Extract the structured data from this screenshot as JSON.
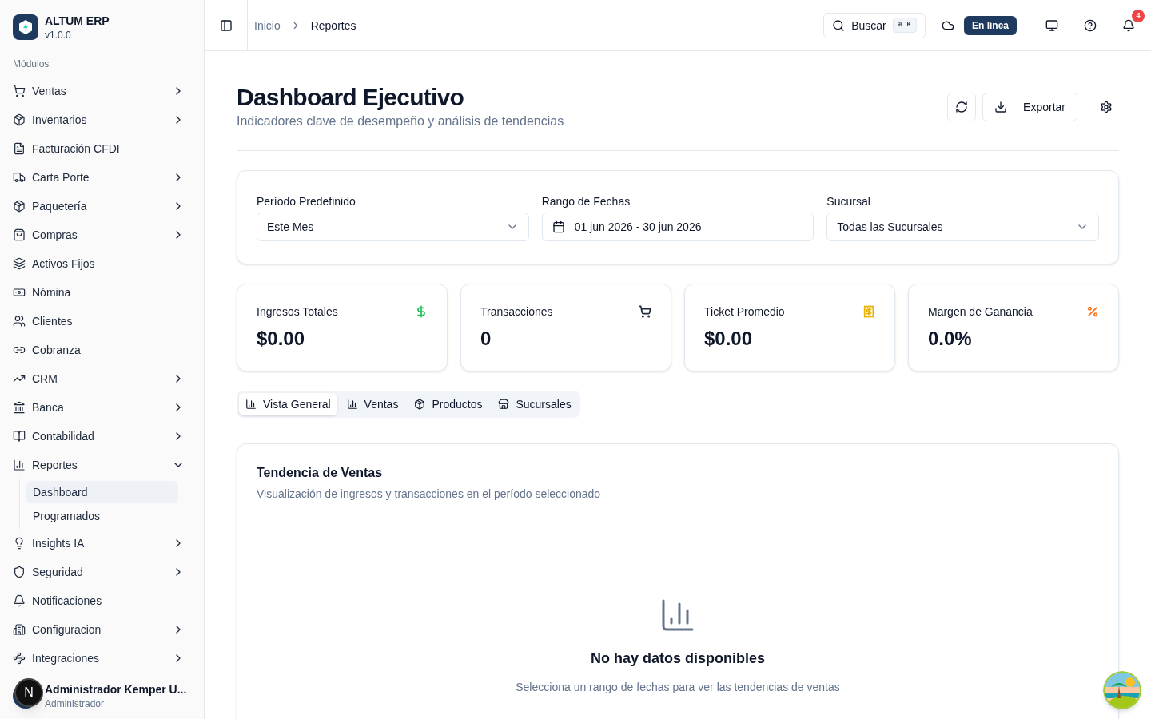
{
  "brand": {
    "name": "ALTUM ERP",
    "version": "v1.0.0"
  },
  "sidebar": {
    "section": "Módulos",
    "items": [
      {
        "label": "Ventas",
        "kind": "group",
        "expanded": false
      },
      {
        "label": "Inventarios",
        "kind": "group",
        "expanded": false
      },
      {
        "label": "Facturación CFDI",
        "kind": "link"
      },
      {
        "label": "Carta Porte",
        "kind": "group",
        "expanded": false
      },
      {
        "label": "Paquetería",
        "kind": "group",
        "expanded": false
      },
      {
        "label": "Compras",
        "kind": "group",
        "expanded": false
      },
      {
        "label": "Activos Fijos",
        "kind": "link"
      },
      {
        "label": "Nómina",
        "kind": "link"
      },
      {
        "label": "Clientes",
        "kind": "link"
      },
      {
        "label": "Cobranza",
        "kind": "link"
      },
      {
        "label": "CRM",
        "kind": "group",
        "expanded": false
      },
      {
        "label": "Banca",
        "kind": "group",
        "expanded": false
      },
      {
        "label": "Contabilidad",
        "kind": "group",
        "expanded": false
      },
      {
        "label": "Reportes",
        "kind": "group",
        "expanded": true,
        "children": [
          {
            "label": "Dashboard",
            "selected": true
          },
          {
            "label": "Programados",
            "selected": false
          }
        ]
      },
      {
        "label": "Insights IA",
        "kind": "group",
        "expanded": false
      },
      {
        "label": "Seguridad",
        "kind": "group",
        "expanded": false
      },
      {
        "label": "Notificaciones",
        "kind": "link"
      },
      {
        "label": "Configuracion",
        "kind": "group",
        "expanded": false
      },
      {
        "label": "Integraciones",
        "kind": "group",
        "expanded": false
      }
    ]
  },
  "user": {
    "name": "Administrador Kemper U...",
    "role": "Administrador"
  },
  "dev_indicator": "N",
  "breadcrumb": [
    "Inicio",
    "Reportes"
  ],
  "topbar": {
    "search": "Buscar",
    "shortcut": "⌘ K",
    "status": "En línea",
    "notifications": "4"
  },
  "page": {
    "title": "Dashboard Ejecutivo",
    "subtitle": "Indicadores clave de desempeño y análisis de tendencias",
    "export": "Exportar"
  },
  "filters": [
    {
      "label": "Período Predefinido",
      "value": "Este Mes",
      "kind": "select"
    },
    {
      "label": "Rango de Fechas",
      "value": "01 jun 2026 - 30 jun 2026",
      "kind": "date"
    },
    {
      "label": "Sucursal",
      "value": "Todas las Sucursales",
      "kind": "select"
    }
  ],
  "kpis": [
    {
      "label": "Ingresos Totales",
      "value": "$0.00",
      "color": "#22c55e"
    },
    {
      "label": "Transacciones",
      "value": "0",
      "color": "#1e293b"
    },
    {
      "label": "Ticket Promedio",
      "value": "$0.00",
      "color": "#eab308"
    },
    {
      "label": "Margen de Ganancia",
      "value": "0.0%",
      "color": "#f97316"
    }
  ],
  "tabs": [
    {
      "label": "Vista General",
      "selected": true
    },
    {
      "label": "Ventas",
      "selected": false
    },
    {
      "label": "Productos",
      "selected": false
    },
    {
      "label": "Sucursales",
      "selected": false
    }
  ],
  "chart_card": {
    "title": "Tendencia de Ventas",
    "subtitle": "Visualización de ingresos y transacciones en el período seleccionado",
    "empty_title": "No hay datos disponibles",
    "empty_text": "Selecciona un rango de fechas para ver las tendencias de ventas"
  }
}
